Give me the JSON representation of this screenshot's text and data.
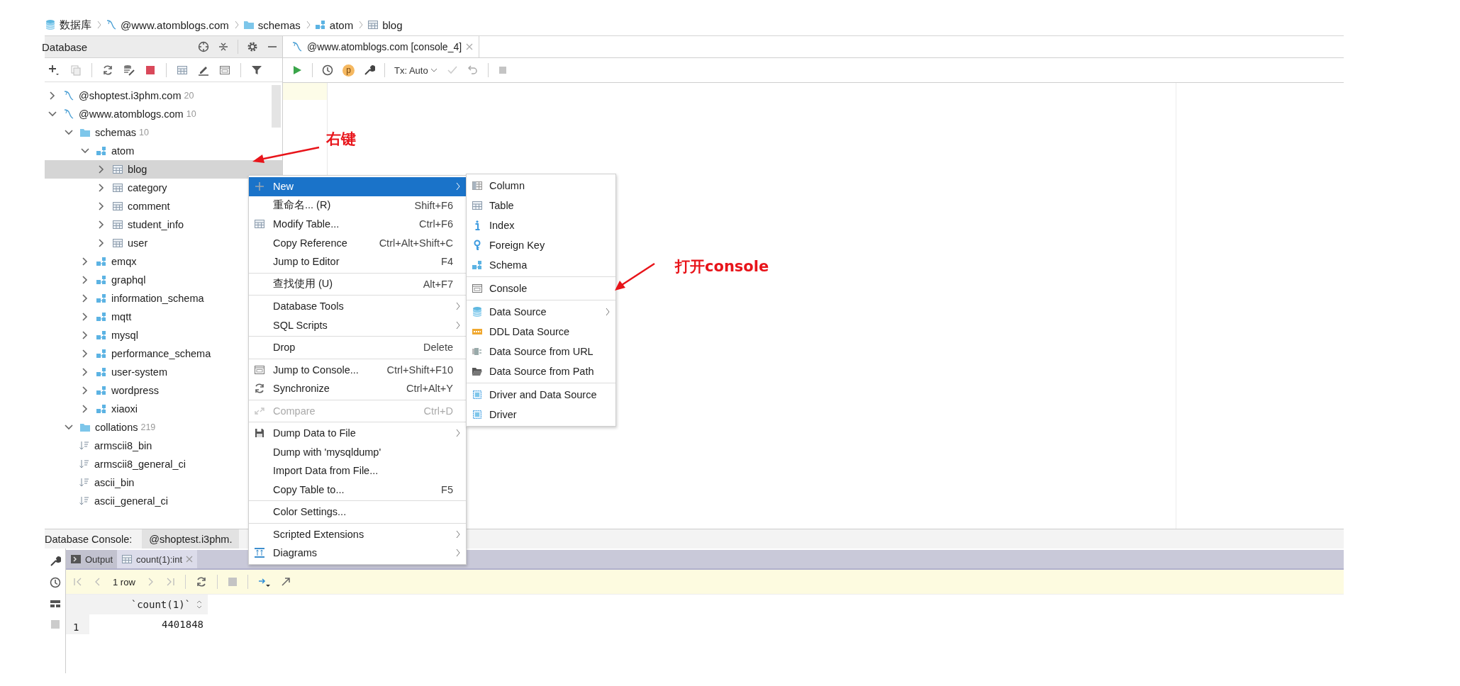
{
  "breadcrumb": [
    {
      "label": "数据库",
      "kind": "database"
    },
    {
      "label": "@www.atomblogs.com",
      "kind": "connection"
    },
    {
      "label": "schemas",
      "kind": "folder"
    },
    {
      "label": "atom",
      "kind": "schema"
    },
    {
      "label": "blog",
      "kind": "table"
    }
  ],
  "database_panel": {
    "title": "Database"
  },
  "tree": [
    {
      "label": "@shoptest.i3phm.com",
      "count": "20",
      "kind": "connection",
      "expanded": false,
      "selected": false
    },
    {
      "label": "@www.atomblogs.com",
      "count": "10",
      "kind": "connection",
      "expanded": true,
      "selected": false,
      "children": [
        {
          "label": "schemas",
          "count": "10",
          "kind": "folder",
          "expanded": true,
          "selected": false,
          "children": [
            {
              "label": "atom",
              "kind": "schema",
              "expanded": true,
              "selected": false,
              "children": [
                {
                  "label": "blog",
                  "kind": "table",
                  "expanded": false,
                  "selected": true
                },
                {
                  "label": "category",
                  "kind": "table",
                  "expanded": false,
                  "selected": false
                },
                {
                  "label": "comment",
                  "kind": "table",
                  "expanded": false,
                  "selected": false
                },
                {
                  "label": "student_info",
                  "kind": "table",
                  "expanded": false,
                  "selected": false
                },
                {
                  "label": "user",
                  "kind": "table",
                  "expanded": false,
                  "selected": false
                }
              ]
            },
            {
              "label": "emqx",
              "kind": "schema",
              "expanded": false,
              "selected": false
            },
            {
              "label": "graphql",
              "kind": "schema",
              "expanded": false,
              "selected": false
            },
            {
              "label": "information_schema",
              "kind": "schema",
              "expanded": false,
              "selected": false
            },
            {
              "label": "mqtt",
              "kind": "schema",
              "expanded": false,
              "selected": false
            },
            {
              "label": "mysql",
              "kind": "schema",
              "expanded": false,
              "selected": false
            },
            {
              "label": "performance_schema",
              "kind": "schema",
              "expanded": false,
              "selected": false
            },
            {
              "label": "user-system",
              "kind": "schema",
              "expanded": false,
              "selected": false
            },
            {
              "label": "wordpress",
              "kind": "schema",
              "expanded": false,
              "selected": false
            },
            {
              "label": "xiaoxi",
              "kind": "schema",
              "expanded": false,
              "selected": false
            }
          ]
        },
        {
          "label": "collations",
          "count": "219",
          "kind": "folder",
          "expanded": true,
          "selected": false,
          "children": [
            {
              "label": "armscii8_bin",
              "kind": "collation",
              "selected": false
            },
            {
              "label": "armscii8_general_ci",
              "kind": "collation",
              "selected": false
            },
            {
              "label": "ascii_bin",
              "kind": "collation",
              "selected": false
            },
            {
              "label": "ascii_general_ci",
              "kind": "collation",
              "selected": false
            }
          ]
        }
      ]
    }
  ],
  "editor_tab": {
    "label": "@www.atomblogs.com [console_4]"
  },
  "editor_toolbar": {
    "profile_badge": "p",
    "tx_mode": "Tx: Auto"
  },
  "context_menu": {
    "sections": [
      [
        {
          "label": "New",
          "kind": "plus",
          "submenu": true,
          "disabled": false,
          "selected": true
        },
        {
          "label": "重命名... (R)",
          "shortcut": "Shift+F6",
          "submenu": false,
          "disabled": false,
          "selected": false
        },
        {
          "label": "Modify Table...",
          "kind": "table",
          "shortcut": "Ctrl+F6",
          "submenu": false,
          "disabled": false,
          "selected": false
        },
        {
          "label": "Copy Reference",
          "shortcut": "Ctrl+Alt+Shift+C",
          "submenu": false,
          "disabled": false,
          "selected": false
        },
        {
          "label": "Jump to Editor",
          "shortcut": "F4",
          "submenu": false,
          "disabled": false,
          "selected": false
        }
      ],
      [
        {
          "label": "查找使用 (U)",
          "shortcut": "Alt+F7",
          "submenu": false,
          "disabled": false,
          "selected": false
        }
      ],
      [
        {
          "label": "Database Tools",
          "submenu": true,
          "disabled": false,
          "selected": false
        },
        {
          "label": "SQL Scripts",
          "submenu": true,
          "disabled": false,
          "selected": false
        }
      ],
      [
        {
          "label": "Drop",
          "shortcut": "Delete",
          "submenu": false,
          "disabled": false,
          "selected": false
        }
      ],
      [
        {
          "label": "Jump to Console...",
          "kind": "console",
          "shortcut": "Ctrl+Shift+F10",
          "submenu": false,
          "disabled": false,
          "selected": false
        },
        {
          "label": "Synchronize",
          "kind": "sync",
          "shortcut": "Ctrl+Alt+Y",
          "submenu": false,
          "disabled": false,
          "selected": false
        }
      ],
      [
        {
          "label": "Compare",
          "kind": "compare",
          "shortcut": "Ctrl+D",
          "submenu": false,
          "disabled": true,
          "selected": false
        }
      ],
      [
        {
          "label": "Dump Data to File",
          "kind": "save",
          "submenu": true,
          "disabled": false,
          "selected": false
        },
        {
          "label": "Dump with 'mysqldump'",
          "submenu": false,
          "disabled": false,
          "selected": false
        },
        {
          "label": "Import Data from File...",
          "submenu": false,
          "disabled": false,
          "selected": false
        },
        {
          "label": "Copy Table to...",
          "shortcut": "F5",
          "submenu": false,
          "disabled": false,
          "selected": false
        }
      ],
      [
        {
          "label": "Color Settings...",
          "submenu": false,
          "disabled": false,
          "selected": false
        }
      ],
      [
        {
          "label": "Scripted Extensions",
          "submenu": true,
          "disabled": false,
          "selected": false
        },
        {
          "label": "Diagrams",
          "kind": "diagram",
          "submenu": true,
          "disabled": false,
          "selected": false
        }
      ]
    ]
  },
  "submenu": {
    "sections": [
      [
        {
          "label": "Column",
          "kind": "column",
          "submenu": false,
          "disabled": false,
          "selected": false
        },
        {
          "label": "Table",
          "kind": "table",
          "submenu": false,
          "disabled": false,
          "selected": false
        },
        {
          "label": "Index",
          "kind": "index",
          "submenu": false,
          "disabled": false,
          "selected": false
        },
        {
          "label": "Foreign Key",
          "kind": "key",
          "submenu": false,
          "disabled": false,
          "selected": false
        },
        {
          "label": "Schema",
          "kind": "schema",
          "submenu": false,
          "disabled": false,
          "selected": false
        }
      ],
      [
        {
          "label": "Console",
          "kind": "console",
          "submenu": false,
          "disabled": false,
          "selected": false
        }
      ],
      [
        {
          "label": "Data Source",
          "kind": "database",
          "submenu": true,
          "disabled": false,
          "selected": false
        },
        {
          "label": "DDL Data Source",
          "kind": "ddl",
          "submenu": false,
          "disabled": false,
          "selected": false
        },
        {
          "label": "Data Source from URL",
          "kind": "url",
          "submenu": false,
          "disabled": false,
          "selected": false
        },
        {
          "label": "Data Source from Path",
          "kind": "path",
          "submenu": false,
          "disabled": false,
          "selected": false
        }
      ],
      [
        {
          "label": "Driver and Data Source",
          "kind": "driver",
          "submenu": false,
          "disabled": false,
          "selected": false
        },
        {
          "label": "Driver",
          "kind": "driver",
          "submenu": false,
          "disabled": false,
          "selected": false
        }
      ]
    ]
  },
  "bottom_panel": {
    "title": "Database Console:",
    "session_tab": "@shoptest.i3phm.",
    "tabs": [
      {
        "label": "Output",
        "kind": "output",
        "selected": false
      },
      {
        "label": "count(1):int",
        "kind": "table",
        "selected": true
      }
    ],
    "row_count": "1 row",
    "columns": [
      "`count(1)`"
    ],
    "rows": [
      {
        "number": "1",
        "values": [
          "4401848"
        ]
      }
    ]
  },
  "annotations": [
    {
      "text": "右键"
    },
    {
      "text": "打开console"
    }
  ]
}
